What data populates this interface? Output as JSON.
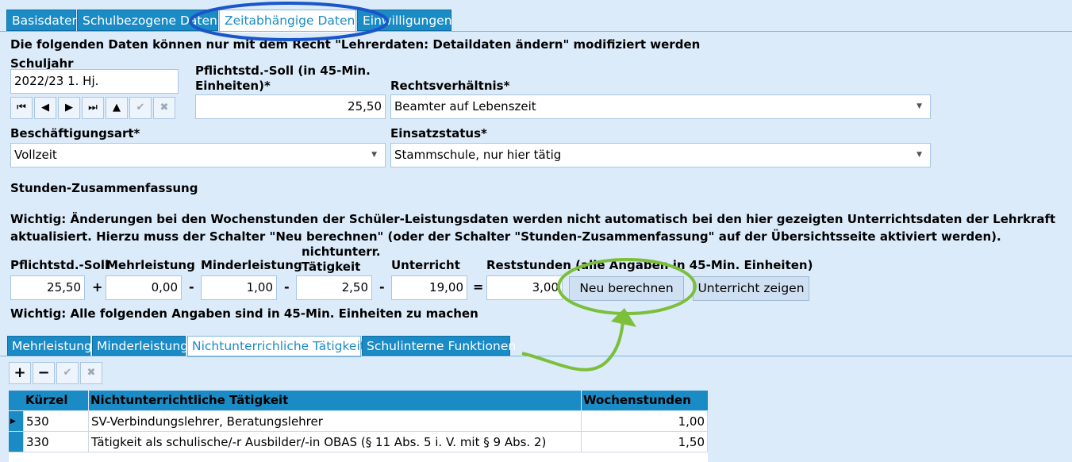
{
  "tabs": [
    "Basisdaten",
    "Schulbezogene Daten",
    "Zeitabhängige Daten",
    "Einwilligungen"
  ],
  "notice": "Die folgenden Daten können nur mit dem Recht \"Lehrerdaten: Detaildaten ändern\" modifiziert werden",
  "schuljahr": {
    "label": "Schuljahr",
    "value": "2022/23 1. Hj."
  },
  "pflicht_soll": {
    "label": "Pflichtstd.-Soll (in 45-Min. Einheiten)*",
    "value": "25,50"
  },
  "rechtsverhaeltnis": {
    "label": "Rechtsverhältnis*",
    "value": "Beamter auf Lebenszeit"
  },
  "beschaeftigungsart": {
    "label": "Beschäftigungsart*",
    "value": "Vollzeit"
  },
  "einsatzstatus": {
    "label": "Einsatzstatus*",
    "value": "Stammschule, nur hier tätig"
  },
  "summary": {
    "heading": "Stunden-Zusammenfassung",
    "warning": "Wichtig: Änderungen bei den Wochenstunden der Schüler-Leistungsdaten werden nicht automatisch bei den hier gezeigten Unterrichtsdaten der Lehrkraft aktualisiert. Hierzu muss der Schalter \"Neu berechnen\" (oder der Schalter \"Stunden-Zusammenfassung\" auf der Übersichtsseite aktiviert werden).",
    "labels": {
      "soll": "Pflichtstd.-Soll",
      "mehr": "Mehrleistung",
      "minder": "Minderleistung",
      "nichtunterr": "nichtunterr. Tätigkeit",
      "unterricht": "Unterricht",
      "rest": "Reststunden (alle Angaben in 45-Min. Einheiten)"
    },
    "values": {
      "soll": "25,50",
      "mehr": "0,00",
      "minder": "1,00",
      "nichtunterr": "2,50",
      "unterricht": "19,00",
      "rest": "3,00"
    },
    "ops": [
      "+",
      "-",
      "-",
      "-",
      "="
    ],
    "btn_neu": "Neu berechnen",
    "btn_unterricht": "Unterricht zeigen",
    "note": "Wichtig: Alle folgenden Angaben sind in 45-Min. Einheiten zu machen"
  },
  "subtabs": [
    "Mehrleistung",
    "Minderleistung",
    "Nichtunterrichliche Tätigkeit",
    "Schulinterne Funktionen"
  ],
  "grid": {
    "headers": [
      "Kürzel",
      "Nichtunterrichtliche Tätigkeit",
      "Wochenstunden"
    ],
    "rows": [
      [
        "530",
        "SV-Verbindungslehrer, Beratungslehrer",
        "1,00"
      ],
      [
        "330",
        "Tätigkeit als schulische/-r Ausbilder/-in OBAS (§ 11 Abs. 5 i. V. mit § 9 Abs. 2)",
        "1,50"
      ]
    ]
  },
  "colors": {
    "tab": "#1b8bc6",
    "highlight_blue": "#1a56c9",
    "highlight_green": "#7cbf3a",
    "background": "#dcebfa"
  }
}
